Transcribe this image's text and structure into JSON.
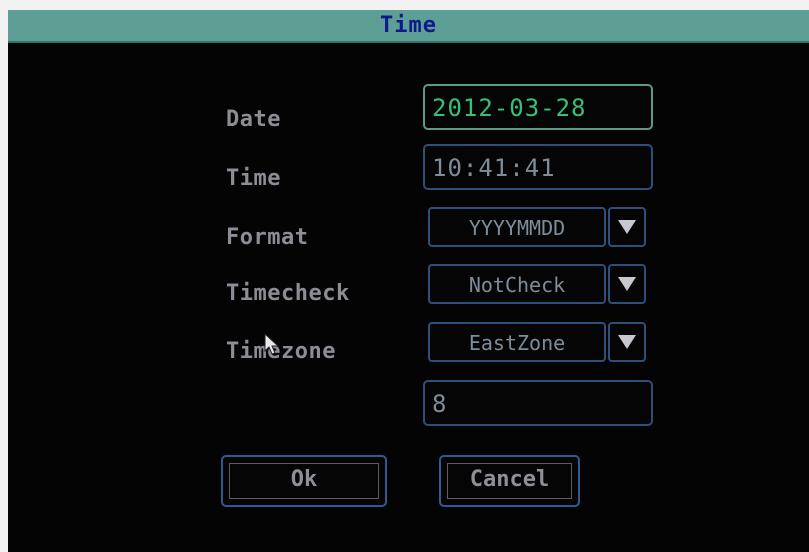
{
  "dialog": {
    "title": "Time"
  },
  "labels": {
    "date": "Date",
    "time": "Time",
    "format": "Format",
    "timecheck": "Timecheck",
    "timezone": "Timezone"
  },
  "fields": {
    "date_value": "2012-03-28",
    "time_value": "10:41:41",
    "format_value": "YYYYMMDD",
    "timecheck_value": "NotCheck",
    "timezone_value": "EastZone",
    "zone_offset_value": "8"
  },
  "buttons": {
    "ok": "Ok",
    "cancel": "Cancel"
  },
  "icons": {
    "dropdown": "triangle-down-icon",
    "cursor": "mouse-pointer-icon"
  },
  "colors": {
    "title_bar": "#5e9f95",
    "title_text": "#10188e",
    "background": "#040404",
    "active_border": "#5a9a86",
    "active_text": "#37c07a",
    "field_border": "#2d4f7c"
  }
}
